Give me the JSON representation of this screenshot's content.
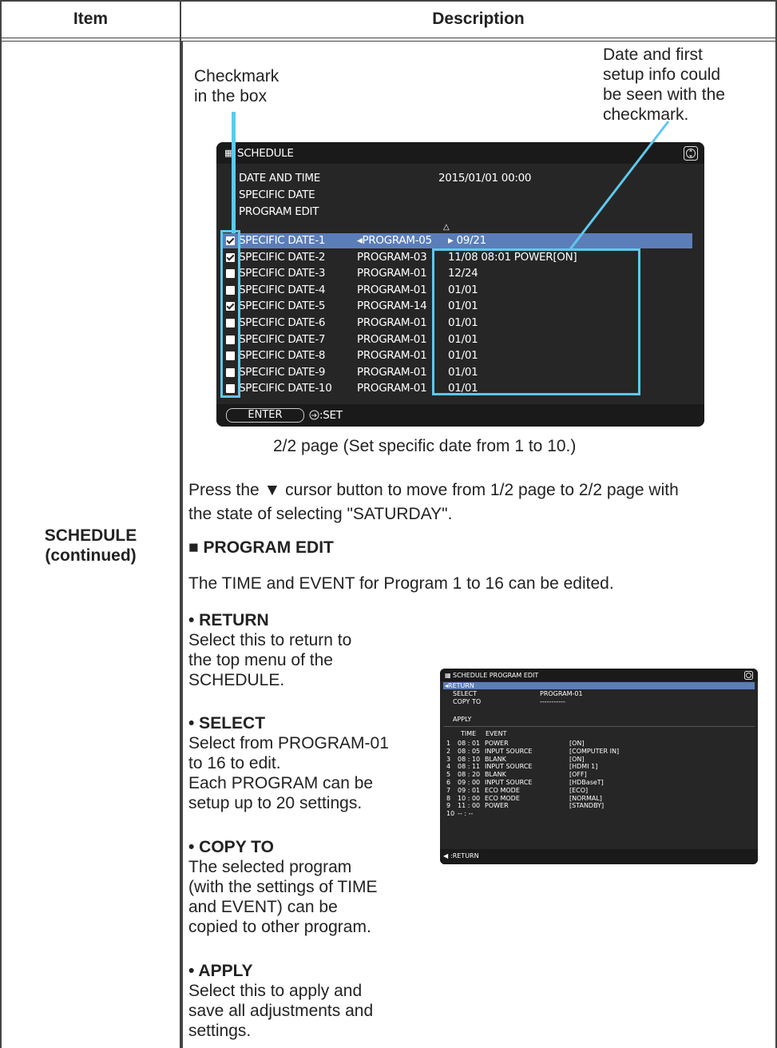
{
  "table": {
    "col_item": "Item",
    "col_description": "Description",
    "item_name_line1": "SCHEDULE",
    "item_name_line2": "(continued)"
  },
  "annotations": {
    "checkmark_l1": "Checkmark",
    "checkmark_l2": "in the box",
    "date_l1": "Date and first",
    "date_l2": "setup info could",
    "date_l3": "be seen with the",
    "date_l4": "checkmark."
  },
  "schedule_screen": {
    "title": "SCHEDULE",
    "date_and_time_label": "DATE AND TIME",
    "date_and_time_value": "2015/01/01 00:00",
    "specific_date_label": "SPECIFIC DATE",
    "program_edit_label": "PROGRAM EDIT",
    "scroll_up_glyph": "△",
    "rows": [
      {
        "name": "SPECIFIC DATE-1",
        "program": "◂PROGRAM-05",
        "date": "▸ 09/21",
        "checked": true
      },
      {
        "name": "SPECIFIC DATE-2",
        "program": "PROGRAM-03",
        "date": "11/08 08:01 POWER[ON]",
        "checked": true
      },
      {
        "name": "SPECIFIC DATE-3",
        "program": "PROGRAM-01",
        "date": "12/24",
        "checked": false
      },
      {
        "name": "SPECIFIC DATE-4",
        "program": "PROGRAM-01",
        "date": "01/01",
        "checked": false
      },
      {
        "name": "SPECIFIC DATE-5",
        "program": "PROGRAM-14",
        "date": "01/01",
        "checked": true
      },
      {
        "name": "SPECIFIC DATE-6",
        "program": "PROGRAM-01",
        "date": "01/01",
        "checked": false
      },
      {
        "name": "SPECIFIC DATE-7",
        "program": "PROGRAM-01",
        "date": "01/01",
        "checked": false
      },
      {
        "name": "SPECIFIC DATE-8",
        "program": "PROGRAM-01",
        "date": "01/01",
        "checked": false
      },
      {
        "name": "SPECIFIC DATE-9",
        "program": "PROGRAM-01",
        "date": "01/01",
        "checked": false
      },
      {
        "name": "SPECIFIC DATE-10",
        "program": "PROGRAM-01",
        "date": "01/01",
        "checked": false
      }
    ],
    "enter_label": "ENTER",
    "set_label": ":SET"
  },
  "caption_page": "2/2 page (Set specific date from 1 to 10.)",
  "para_press_l1": "Press the ▼ cursor button to move from 1/2 page to 2/2 page with",
  "para_press_l2": "the state of selecting \"SATURDAY\".",
  "program_edit_heading": "■ PROGRAM EDIT",
  "program_edit_intro": "The TIME and EVENT for Program 1 to 16 can be edited.",
  "return_item": {
    "title": "• RETURN",
    "l1": "Select this to return to",
    "l2": "the top menu of the",
    "l3": "SCHEDULE."
  },
  "select_item": {
    "title": "• SELECT",
    "l1": "Select from PROGRAM-01",
    "l2": "to 16 to edit.",
    "l3": "Each PROGRAM can be",
    "l4": "setup up to 20 settings."
  },
  "copyto_item": {
    "title": "• COPY TO",
    "l1": "The selected program",
    "l2": "(with the settings of TIME",
    "l3": "and EVENT) can be",
    "l4": "copied to other program."
  },
  "apply_item": {
    "title": "• APPLY",
    "l1": "Select this to apply and",
    "l2": "save all adjustments and",
    "l3": "settings."
  },
  "program_edit_screen": {
    "title": "SCHEDULE  PROGRAM EDIT",
    "return_label": "◂RETURN",
    "select_label": "SELECT",
    "select_value": "PROGRAM-01",
    "copy_to_label": "COPY TO",
    "copy_to_value": "-----------",
    "apply_label": "APPLY",
    "col_time": "TIME",
    "col_event": "EVENT",
    "rows": [
      {
        "n": "1",
        "time": "08 : 01",
        "event": "POWER",
        "value": "[ON]"
      },
      {
        "n": "2",
        "time": "08 : 05",
        "event": "INPUT SOURCE",
        "value": "[COMPUTER IN]"
      },
      {
        "n": "3",
        "time": "08 : 10",
        "event": "BLANK",
        "value": "[ON]"
      },
      {
        "n": "4",
        "time": "08 : 11",
        "event": "INPUT SOURCE",
        "value": "[HDMI 1]"
      },
      {
        "n": "5",
        "time": "08 : 20",
        "event": "BLANK",
        "value": "[OFF]"
      },
      {
        "n": "6",
        "time": "09 : 00",
        "event": "INPUT SOURCE",
        "value": "[HDBaseT]"
      },
      {
        "n": "7",
        "time": "09 : 01",
        "event": "ECO MODE",
        "value": "[ECO]"
      },
      {
        "n": "8",
        "time": "10 : 00",
        "event": "ECO MODE",
        "value": "[NORMAL]"
      },
      {
        "n": "9",
        "time": "11 : 00",
        "event": "POWER",
        "value": "[STANDBY]"
      },
      {
        "n": "10",
        "time": "-- : --",
        "event": "",
        "value": ""
      }
    ],
    "footer_label": ":RETURN"
  },
  "colors": {
    "highlight": "#5b7db8",
    "callout": "#5ec8ee",
    "screen_bg": "#262626"
  }
}
